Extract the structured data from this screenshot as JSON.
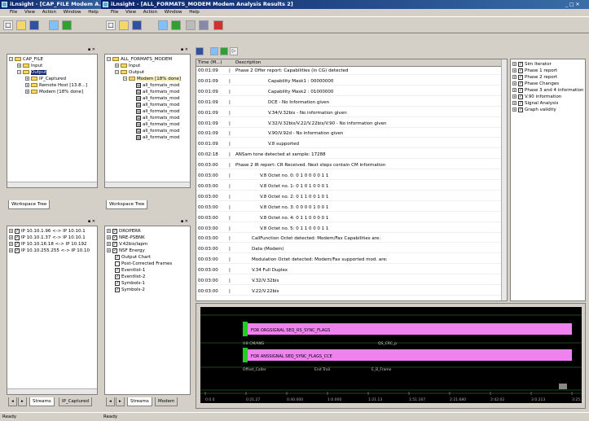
{
  "window1": {
    "title": "iLnsight - [CAP_FILE Modem A...]",
    "menu": [
      "File",
      "View",
      "Action",
      "Window",
      "Help"
    ],
    "tree": [
      "CAP_FILE",
      "Input",
      "Output",
      "IP_Captured",
      "Remote Host [13.8...]",
      "Modem [18% done]"
    ],
    "workspace_tab": "Workspace Tree",
    "streams": [
      "IP 10.10.1.96 <-> IP 10.10.1",
      "IP 10.10.1.37 <-> IP 10.10.1",
      "IP 10.10.16.18 <-> IP 10.192",
      "IP 10.10.255.255 <-> IP 10.10"
    ],
    "bottom_tabs": [
      "Streams",
      "IP_Captured"
    ],
    "status": "Ready"
  },
  "window2": {
    "title": "iLnsight - [ALL_FORMATS_MODEM Modem Analysis Results 2]",
    "menu": [
      "File",
      "View",
      "Action",
      "Window",
      "Help"
    ],
    "tree": [
      "ALL_FORMATS_MODEM",
      "Input",
      "Output",
      "Modem [18% done]",
      "all_formats_mod",
      "all_formats_mod",
      "all_formats_mod",
      "all_formats_mod",
      "all_formats_mod",
      "all_formats_mod",
      "all_formats_mod",
      "all_formats_mod",
      "all_formats_mod"
    ],
    "workspace_tab": "Workspace Tree",
    "streams": [
      "DROPERR",
      "NRE-PSBNK",
      "V.42bis/lapm",
      "NSF Energy",
      "Output Chart",
      "Post-Corrected Frames",
      "Eventlist-1",
      "Eventlist-2",
      "Symbols-1",
      "Symbols-2"
    ],
    "bottom_tabs": [
      "Streams",
      "Modem"
    ],
    "status": "Ready"
  },
  "log": {
    "col_time": "Time (M...)",
    "col_desc": "Description",
    "rows": [
      {
        "t": "00:01:09",
        "d": "Phase 2 Offer report: Capabilities (in CG) detected"
      },
      {
        "t": "00:01:09",
        "d": "Capability Mask1 : 00000000"
      },
      {
        "t": "00:01:09",
        "d": "Capability Mask2 : 01000000"
      },
      {
        "t": "00:01:09",
        "d": "DCE - No Information given"
      },
      {
        "t": "00:01:09",
        "d": "V.34/V.32bis - No information given"
      },
      {
        "t": "00:01:09",
        "d": "V.32/V.32bis/V.22/V.22bis/V.90 - No information given"
      },
      {
        "t": "00:01:09",
        "d": "V.90/V.92d - No information given"
      },
      {
        "t": "00:01:09",
        "d": "V.8 supported"
      },
      {
        "t": "00:02:18",
        "d": "ANSam tone detected at sample: 17288"
      },
      {
        "t": "00:03:00",
        "d": "Phase 2 IR report: CR Received. Next steps contain CM information"
      },
      {
        "t": "00:03:00",
        "d": "V.8 Octet no. 0: 0 1 0 0 0 0 1 1"
      },
      {
        "t": "00:03:00",
        "d": "V.8 Octet no. 1: 0 1 0 1 0 0 0 1"
      },
      {
        "t": "00:03:00",
        "d": "V.8 Octet no. 2: 0 1 1 0 0 1 0 1"
      },
      {
        "t": "00:03:00",
        "d": "V.8 Octet no. 3: 0 0 0 0 1 0 0 1"
      },
      {
        "t": "00:03:00",
        "d": "V.8 Octet no. 4: 0 1 1 0 0 0 0 1"
      },
      {
        "t": "00:03:00",
        "d": "V.8 Octet no. 5: 0 1 1 0 0 0 1 1"
      },
      {
        "t": "00:03:00",
        "d": "CallFunction Octet detected: Modem/Fax Capabilities are:"
      },
      {
        "t": "00:03:00",
        "d": "Data (Modem)"
      },
      {
        "t": "00:03:00",
        "d": "Modulation Octet detected: Modem/Fax supported mod. are:"
      },
      {
        "t": "00:03:00",
        "d": "V.34 Full Duplex"
      },
      {
        "t": "00:03:00",
        "d": "V.32/V.32bis"
      },
      {
        "t": "00:03:00",
        "d": "V.22/V.22bis"
      }
    ]
  },
  "right_list": [
    "Sim Iterator",
    "Phase 1 report",
    "Phase 2 report",
    "Phase Changes",
    "Phase 3 and 4 information",
    "V.90 information",
    "Signal Analysis",
    "Graph validity"
  ],
  "graph": {
    "bar1_label": "FOR ORGSIGNAL SEQ_RS_SYNC_FLAGS",
    "bar1_sub_left": "V.8 CM/ANS",
    "bar1_sub_right": "QS_CRC_p",
    "bar2_label": "FOR ANSSIGNAL SEQ_SYNC_FLAGS_CCE",
    "bar2_sub_left": "Offset_Caller",
    "bar2_sub_mid": "End Trail",
    "bar2_sub_right": "E_B_Frame",
    "ticks": [
      "0:0.0",
      "0:21.27",
      "0:40.000",
      "1:0.000",
      "1:21.13",
      "1:51.167",
      "2:21.680",
      "2:42.02",
      "3:0.213",
      "3:25.40"
    ],
    "colors": {
      "bg": "#000000",
      "bar": "#ee82ee",
      "start": "#22cc22",
      "grid": "#1a4a1a"
    }
  }
}
